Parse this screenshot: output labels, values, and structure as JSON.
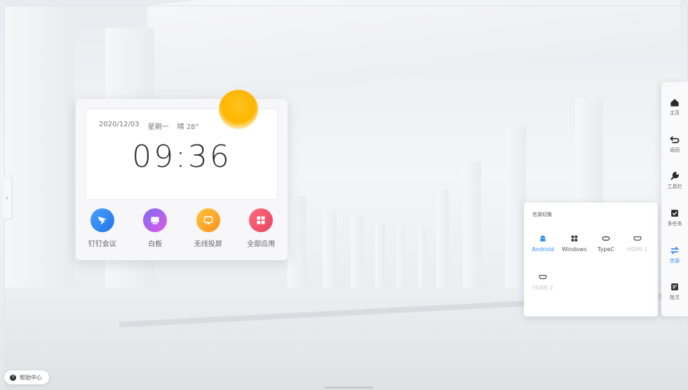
{
  "clock": {
    "date": "2020/12/03",
    "weekday": "星期一",
    "weather": "晴 28°",
    "time": "09:36"
  },
  "apps": [
    {
      "label": "钉钉会议",
      "icon": "dingtalk-icon",
      "color": "#2f8cf5"
    },
    {
      "label": "白板",
      "icon": "whiteboard-icon",
      "color": "#b061f0"
    },
    {
      "label": "无线投屏",
      "icon": "cast-icon",
      "color": "#ffab1f"
    },
    {
      "label": "全部应用",
      "icon": "grid-icon",
      "color": "#f2556d"
    }
  ],
  "sidebar": {
    "items": [
      {
        "label": "主页",
        "icon": "home-icon"
      },
      {
        "label": "返回",
        "icon": "back-icon"
      },
      {
        "label": "工具栏",
        "icon": "wrench-icon"
      },
      {
        "label": "多任务",
        "icon": "multitask-icon"
      },
      {
        "label": "信源",
        "icon": "swap-icon",
        "active": true
      },
      {
        "label": "批注",
        "icon": "annotate-icon"
      }
    ]
  },
  "source_panel": {
    "title": "信源切换",
    "items": [
      {
        "label": "Android",
        "icon": "android-icon",
        "state": "active"
      },
      {
        "label": "Windows",
        "icon": "windows-icon",
        "state": "normal"
      },
      {
        "label": "TypeC",
        "icon": "typec-icon",
        "state": "normal"
      },
      {
        "label": "HDMI 1",
        "icon": "hdmi-icon",
        "state": "disabled"
      },
      {
        "label": "HDMI 2",
        "icon": "hdmi-icon",
        "state": "disabled"
      }
    ]
  },
  "help": {
    "label": "帮助中心"
  },
  "colors": {
    "accent": "#2f8cf5",
    "sun": "#ffb600",
    "disabled": "#c5c8cf"
  }
}
